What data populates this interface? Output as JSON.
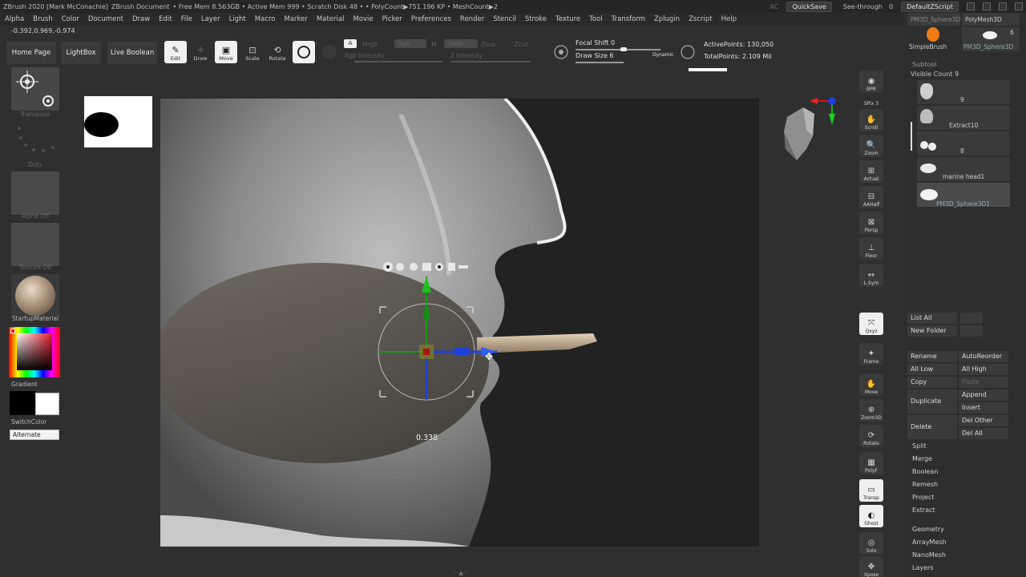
{
  "titlebar": {
    "app": "ZBrush 2020 [Mark McConachie]",
    "doc": "ZBrush Document",
    "stats": "• Free Mem 8.563GB • Active Mem 999 • Scratch Disk 48 • • PolyCount▶751.196 KP • MeshCount▶2",
    "ac": "AC",
    "quicksave": "QuickSave",
    "seethrough": "See-through",
    "seethrough_val": "0",
    "script": "DefaultZScript"
  },
  "menu": [
    "Alpha",
    "Brush",
    "Color",
    "Document",
    "Draw",
    "Edit",
    "File",
    "Layer",
    "Light",
    "Macro",
    "Marker",
    "Material",
    "Movie",
    "Picker",
    "Preferences",
    "Render",
    "Stencil",
    "Stroke",
    "Texture",
    "Tool",
    "Transform",
    "Zplugin",
    "Zscript",
    "Help"
  ],
  "coords": "-0.392,0.969,-0.974",
  "shelf": {
    "home": "Home Page",
    "lightbox": "LightBox",
    "liveboolean": "Live Boolean",
    "edit": "Edit",
    "draw": "Draw",
    "move": "Move",
    "scale": "Scale",
    "rotate": "Rotate",
    "mrgb": "Mrgb",
    "rgb": "Rgb",
    "m": "M",
    "zadd": "Zadd",
    "zsub": "Zsub",
    "zcut": "Zcut",
    "rgb_intensity": "Rgb Intensity",
    "z_intensity": "Z Intensity",
    "focal_shift": "Focal Shift 0",
    "draw_size": "Draw Size 6",
    "dynamic": "Dynamic",
    "active_points": "ActivePoints: 130,050",
    "total_points": "TotalPoints: 2.109 Mil"
  },
  "left": {
    "transpose": "Transpose",
    "dots": "Dots",
    "alpha_off": "Alpha Off",
    "texture_off": "Texture Off",
    "material": "StartupMaterial",
    "gradient": "Gradient",
    "switchcolor": "SwitchColor",
    "alternate": "Alternate"
  },
  "canvas": {
    "readout": "0.338"
  },
  "dock": [
    "BPR",
    "SPix 3",
    "Scroll",
    "Zoom",
    "Actual",
    "AAHalf",
    "Persp",
    "Floor",
    "L.Sym",
    "Qxyz",
    "Frame",
    "Move",
    "Zoom3D",
    "Rotate",
    "PolyF",
    "Transp",
    "Ghost",
    "Solo",
    "Xpose"
  ],
  "rpanel": {
    "tool_top_left": "PM3D_Sphere3D",
    "tool_top_right": "PolyMesh3D",
    "tool_count": "6",
    "simplebrush": "SimpleBrush",
    "polymesh_lbl": "PM3D_Sphere3D",
    "subtool": "Subtool",
    "visible_count": "Visible Count 9",
    "subtools": [
      {
        "name": "9"
      },
      {
        "name": "Extract10"
      },
      {
        "name": "8"
      },
      {
        "name": "marine head1"
      },
      {
        "name": "PM3D_Sphere3D1"
      }
    ],
    "list_all": "List All",
    "new_folder": "New Folder",
    "rename": "Rename",
    "autoreorder": "AutoReorder",
    "all_low": "All Low",
    "all_high": "All High",
    "copy": "Copy",
    "paste": "Paste",
    "duplicate": "Duplicate",
    "append": "Append",
    "insert": "Insert",
    "delete": "Delete",
    "del_other": "Del Other",
    "del_all": "Del All",
    "items": [
      "Split",
      "Merge",
      "Boolean",
      "Remesh",
      "Project",
      "Extract"
    ],
    "sections": [
      "Geometry",
      "ArrayMesh",
      "NanoMesh",
      "Layers"
    ]
  }
}
